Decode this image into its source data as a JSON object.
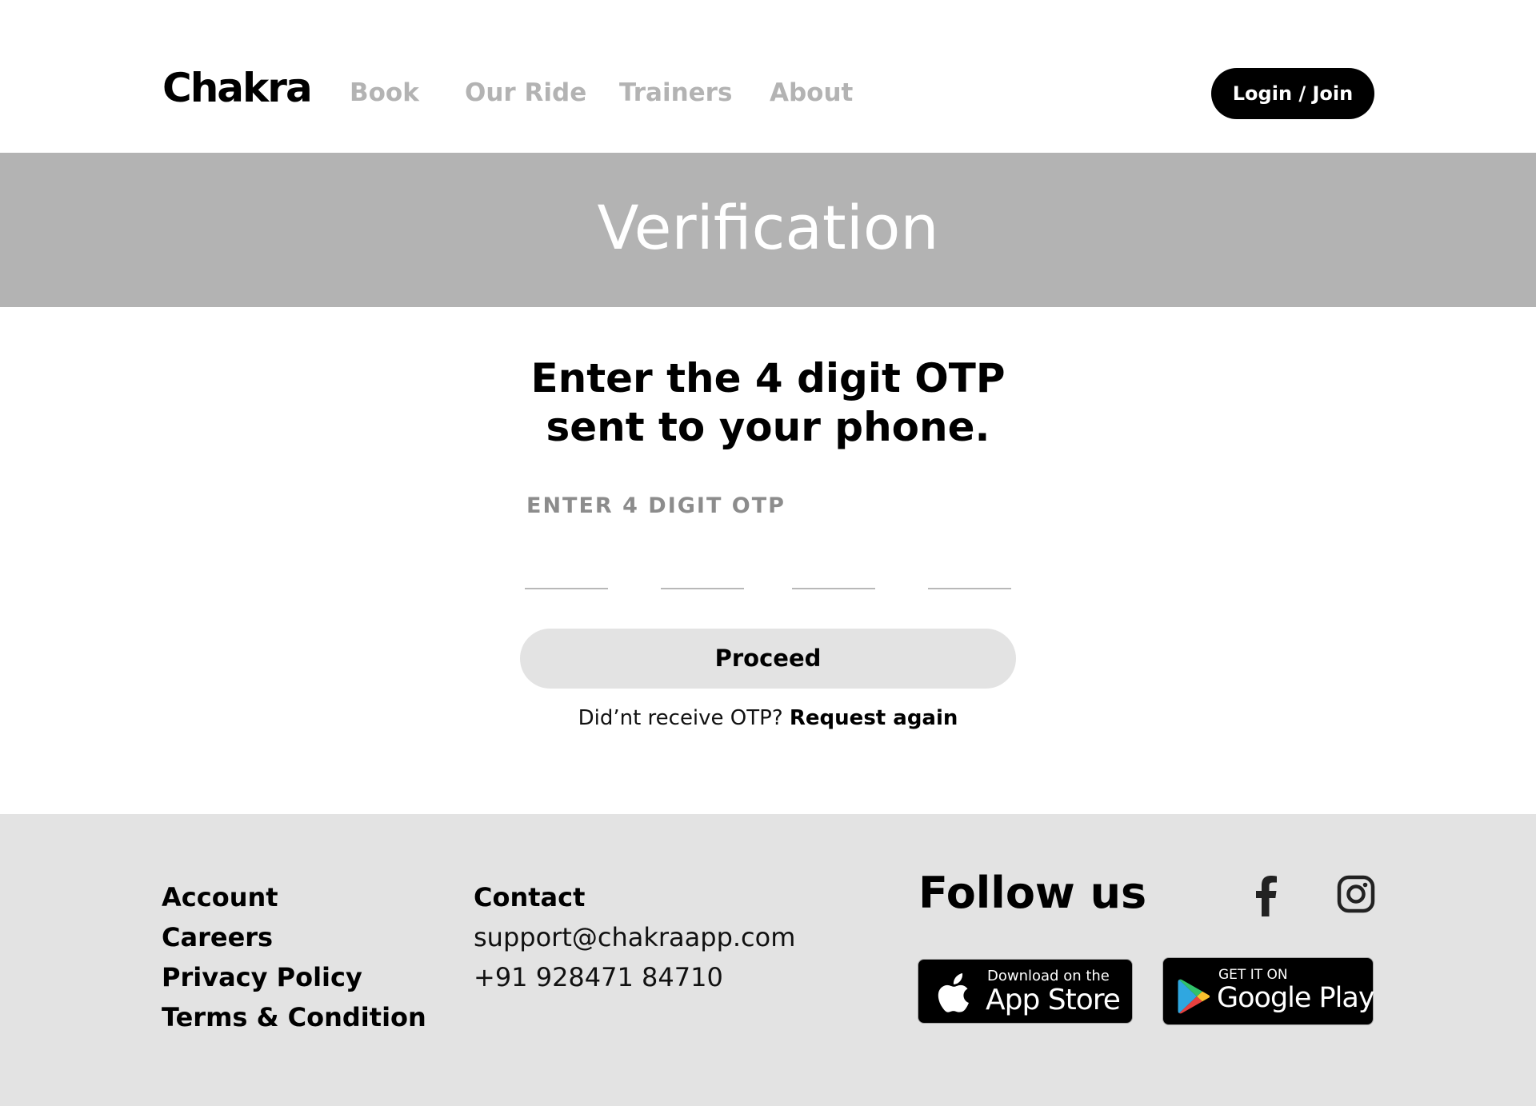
{
  "header": {
    "logo": "Chakra",
    "nav": [
      "Book",
      "Our Ride",
      "Trainers",
      "About"
    ],
    "login_label": "Login / Join"
  },
  "banner": {
    "title": "Verification"
  },
  "main": {
    "heading_line1": "Enter the 4 digit OTP",
    "heading_line2": "sent to your phone.",
    "otp_label": "ENTER 4 DIGIT OTP",
    "otp_values": [
      "",
      "",
      "",
      ""
    ],
    "proceed_label": "Proceed",
    "resend_text": "Did’nt receive OTP?",
    "resend_link": "Request again"
  },
  "footer": {
    "account_links": [
      "Account",
      "Careers",
      "Privacy Policy",
      "Terms & Condition"
    ],
    "contact_heading": "Contact",
    "contact_email": "support@chakraapp.com",
    "contact_phone": "+91 928471 84710",
    "follow_title": "Follow us",
    "social_icons": [
      "facebook-icon",
      "instagram-icon"
    ],
    "app_store": {
      "small": "Download on the",
      "big": "App Store"
    },
    "google_play": {
      "small": "GET IT ON",
      "big": "Google Play"
    }
  },
  "colors": {
    "banner_bg": "#b3b3b3",
    "footer_bg": "#e3e3e3",
    "nav_inactive": "#b3b3b3",
    "primary_button": "#000000",
    "proceed_button": "#e3e3e3"
  }
}
